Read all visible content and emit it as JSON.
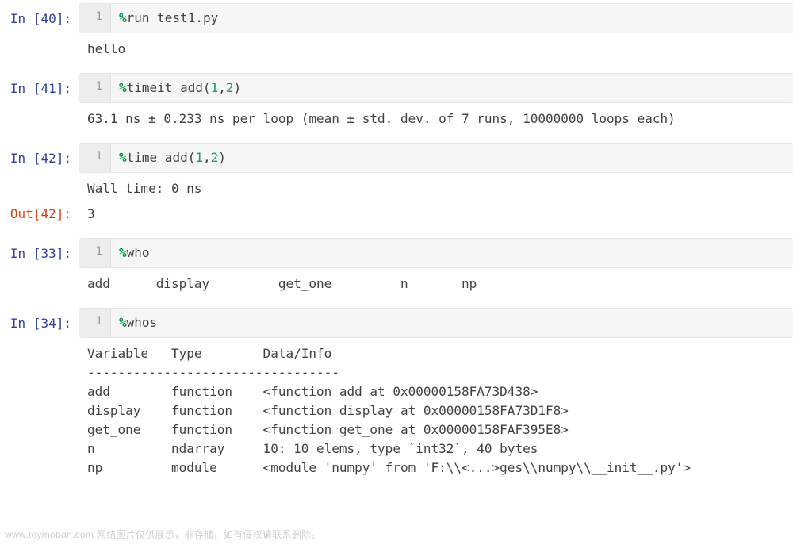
{
  "prompts": {
    "in": "In  ",
    "out": "Out"
  },
  "cells": [
    {
      "n": "40",
      "code": {
        "magic": "%",
        "body": "run test1.py"
      },
      "outputs": [
        {
          "kind": "stdout",
          "text": "hello"
        }
      ]
    },
    {
      "n": "41",
      "code": {
        "magic": "%",
        "body_prefix": "timeit add",
        "args": [
          1,
          2
        ]
      },
      "outputs": [
        {
          "kind": "stdout",
          "text": "63.1 ns ± 0.233 ns per loop (mean ± std. dev. of 7 runs, 10000000 loops each)"
        }
      ]
    },
    {
      "n": "42",
      "code": {
        "magic": "%",
        "body_prefix": "time add",
        "args": [
          1,
          2
        ]
      },
      "outputs": [
        {
          "kind": "stdout",
          "text": "Wall time: 0 ns"
        },
        {
          "kind": "result",
          "text": "3"
        }
      ]
    },
    {
      "n": "33",
      "code": {
        "magic": "%",
        "body": "who"
      },
      "outputs": [
        {
          "kind": "stdout",
          "text": "add\t display\t get_one\t n\t np\t "
        }
      ]
    },
    {
      "n": "34",
      "code": {
        "magic": "%",
        "body": "whos"
      },
      "outputs": [
        {
          "kind": "stdout",
          "text": "Variable   Type        Data/Info\n---------------------------------\nadd        function    <function add at 0x00000158FA73D438>\ndisplay    function    <function display at 0x00000158FA73D1F8>\nget_one    function    <function get_one at 0x00000158FAF395E8>\nn          ndarray     10: 10 elems, type `int32`, 40 bytes\nnp         module      <module 'numpy' from 'F:\\\\<...>ges\\\\numpy\\\\__init__.py'>"
        }
      ]
    }
  ],
  "watermark": "www.toymoban.com 网络图片仅供展示，非存储，如有侵权请联系删除。"
}
